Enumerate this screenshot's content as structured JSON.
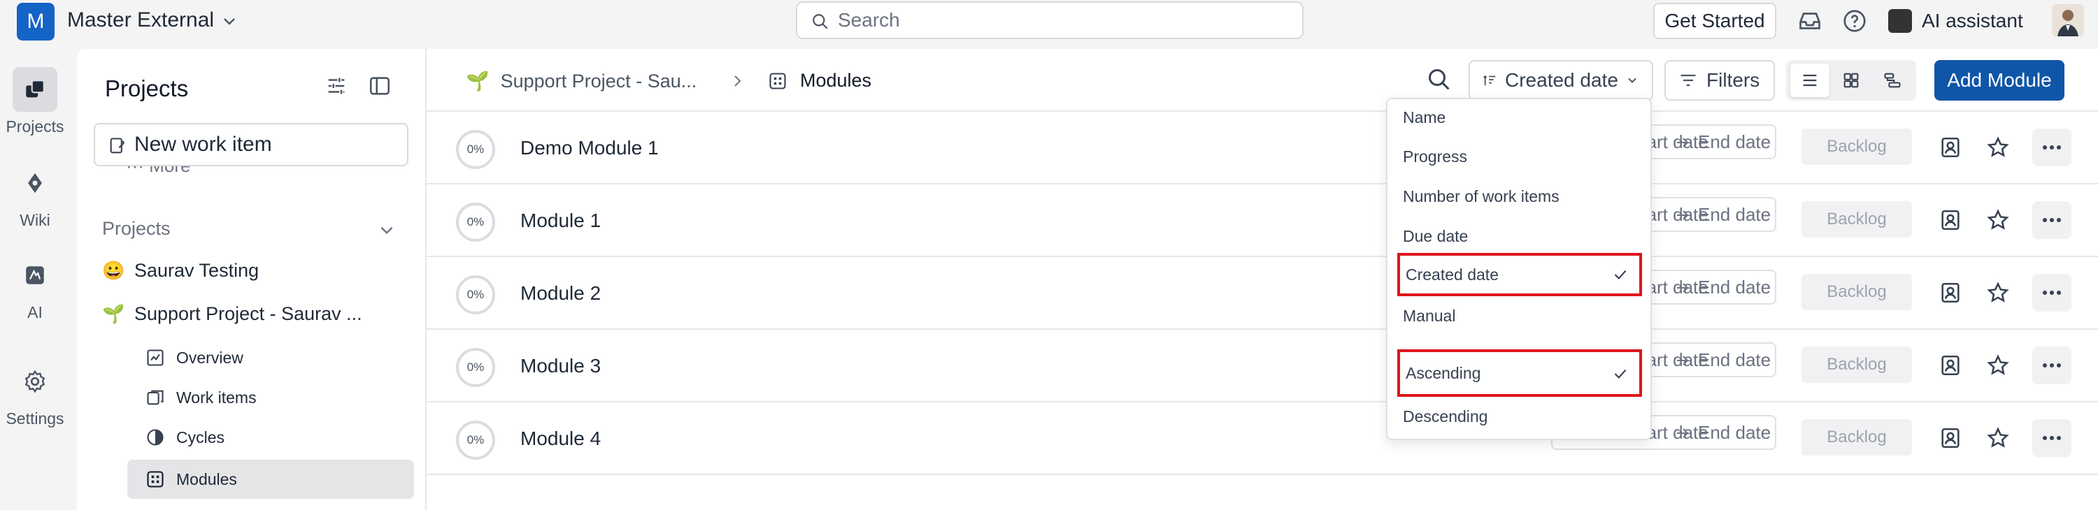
{
  "topbar": {
    "workspace_initial": "M",
    "workspace_name": "Master External",
    "search_placeholder": "Search",
    "get_started_label": "Get Started",
    "ai_assistant_label": "AI assistant"
  },
  "rail": {
    "items": [
      {
        "label": "Projects",
        "icon": "projects-icon",
        "active": true
      },
      {
        "label": "Wiki",
        "icon": "wiki-icon",
        "active": false
      },
      {
        "label": "AI",
        "icon": "ai-icon",
        "active": false
      },
      {
        "label": "Settings",
        "icon": "gear-icon",
        "active": false
      }
    ]
  },
  "sidebar": {
    "title": "Projects",
    "new_item_label": "New work item",
    "more_label": "More",
    "section_label": "Projects",
    "projects": [
      {
        "emoji": "😀",
        "name": "Saurav Testing"
      },
      {
        "emoji": "🌱",
        "name": "Support Project - Saurav ..."
      }
    ],
    "subitems": [
      {
        "label": "Overview",
        "icon": "overview-icon"
      },
      {
        "label": "Work items",
        "icon": "work-items-icon"
      },
      {
        "label": "Cycles",
        "icon": "cycles-icon"
      },
      {
        "label": "Modules",
        "icon": "modules-icon",
        "active": true
      }
    ]
  },
  "header": {
    "project_crumb": "Support Project - Sau...",
    "page_crumb": "Modules",
    "sort_label": "Created date",
    "filters_label": "Filters",
    "add_label": "Add Module"
  },
  "modules": [
    {
      "name": "Demo Module 1",
      "progress": "0%",
      "start": "Start date",
      "end": "End date",
      "status": "Backlog"
    },
    {
      "name": "Module 1",
      "progress": "0%",
      "start": "Start date",
      "end": "End date",
      "status": "Backlog"
    },
    {
      "name": "Module 2",
      "progress": "0%",
      "start": "Start date",
      "end": "End date",
      "status": "Backlog"
    },
    {
      "name": "Module 3",
      "progress": "0%",
      "start": "Start date",
      "end": "End date",
      "status": "Backlog"
    },
    {
      "name": "Module 4",
      "progress": "0%",
      "start": "Start date",
      "end": "End date",
      "status": "Backlog"
    }
  ],
  "sort_menu": {
    "fields": [
      "Name",
      "Progress",
      "Number of work items",
      "Due date",
      "Created date",
      "Manual"
    ],
    "orders": [
      "Ascending",
      "Descending"
    ],
    "selected_field": "Created date",
    "selected_order": "Ascending"
  },
  "colors": {
    "brand": "#0f56a8",
    "highlight": "#e0141b"
  }
}
